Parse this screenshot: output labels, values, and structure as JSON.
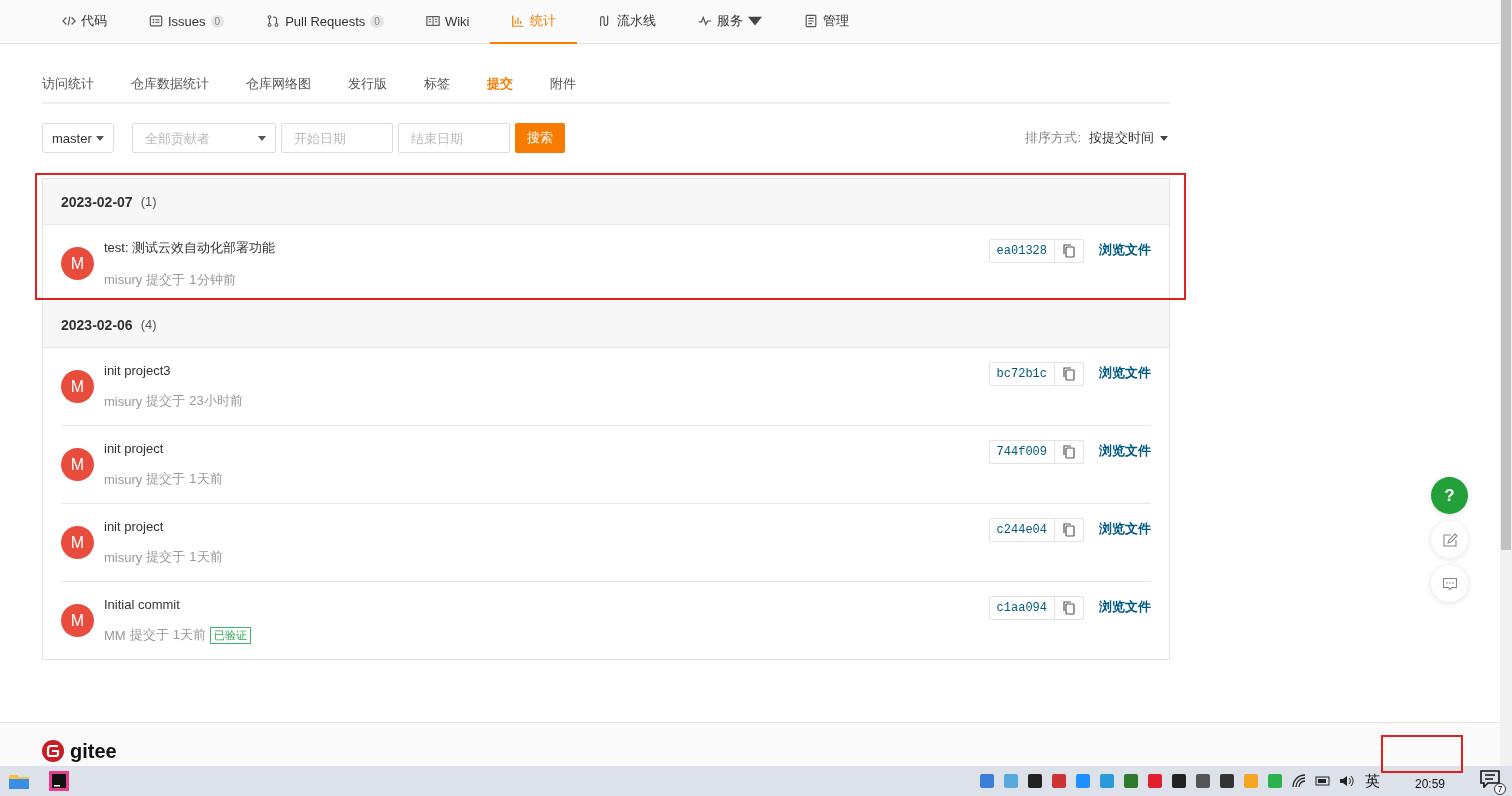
{
  "nav_tabs": [
    {
      "label": "代码",
      "selected": false,
      "dropdown": false
    },
    {
      "label": "Issues",
      "badge": "0",
      "selected": false,
      "dropdown": false
    },
    {
      "label": "Pull Requests",
      "badge": "0",
      "selected": false,
      "dropdown": false
    },
    {
      "label": "Wiki",
      "selected": false,
      "dropdown": false
    },
    {
      "label": "统计",
      "selected": true,
      "dropdown": false
    },
    {
      "label": "流水线",
      "selected": false,
      "dropdown": false
    },
    {
      "label": "服务",
      "selected": false,
      "dropdown": true
    },
    {
      "label": "管理",
      "selected": false,
      "dropdown": false
    }
  ],
  "sub_tabs": [
    {
      "label": "访问统计",
      "selected": false
    },
    {
      "label": "仓库数据统计",
      "selected": false
    },
    {
      "label": "仓库网络图",
      "selected": false
    },
    {
      "label": "发行版",
      "selected": false
    },
    {
      "label": "标签",
      "selected": false
    },
    {
      "label": "提交",
      "selected": true
    },
    {
      "label": "附件",
      "selected": false
    }
  ],
  "filters": {
    "branch": "master",
    "contributor_placeholder": "全部贡献者",
    "start_placeholder": "开始日期",
    "end_placeholder": "结束日期",
    "search_button": "搜索",
    "sort_label": "排序方式:",
    "sort_value": "按提交时间"
  },
  "groups": [
    {
      "date": "2023-02-07",
      "count": "(1)",
      "highlighted": true,
      "commits": [
        {
          "avatar": "M",
          "message": "test: 测试云效自动化部署功能",
          "author": "misury",
          "verb": "提交于",
          "time": "1分钟前",
          "hash": "ea01328",
          "browse": "浏览文件"
        }
      ]
    },
    {
      "date": "2023-02-06",
      "count": "(4)",
      "highlighted": false,
      "commits": [
        {
          "avatar": "M",
          "message": "init project3",
          "author": "misury",
          "verb": "提交于",
          "time": "23小时前",
          "hash": "bc72b1c",
          "browse": "浏览文件"
        },
        {
          "avatar": "M",
          "message": "init project",
          "author": "misury",
          "verb": "提交于",
          "time": "1天前",
          "hash": "744f009",
          "browse": "浏览文件"
        },
        {
          "avatar": "M",
          "message": "init project",
          "author": "misury",
          "verb": "提交于",
          "time": "1天前",
          "hash": "c244e04",
          "browse": "浏览文件"
        },
        {
          "avatar": "M",
          "message": "Initial commit",
          "author": "MM",
          "verb": "提交于",
          "time": "1天前",
          "verified": "已验证",
          "hash": "c1aa094",
          "browse": "浏览文件"
        }
      ]
    }
  ],
  "float_buttons": {
    "help": "?"
  },
  "footer": {
    "logo": "gitee"
  },
  "taskbar": {
    "ime": "英",
    "time": "20:59",
    "notifications": "7",
    "clock_highlighted": true
  }
}
